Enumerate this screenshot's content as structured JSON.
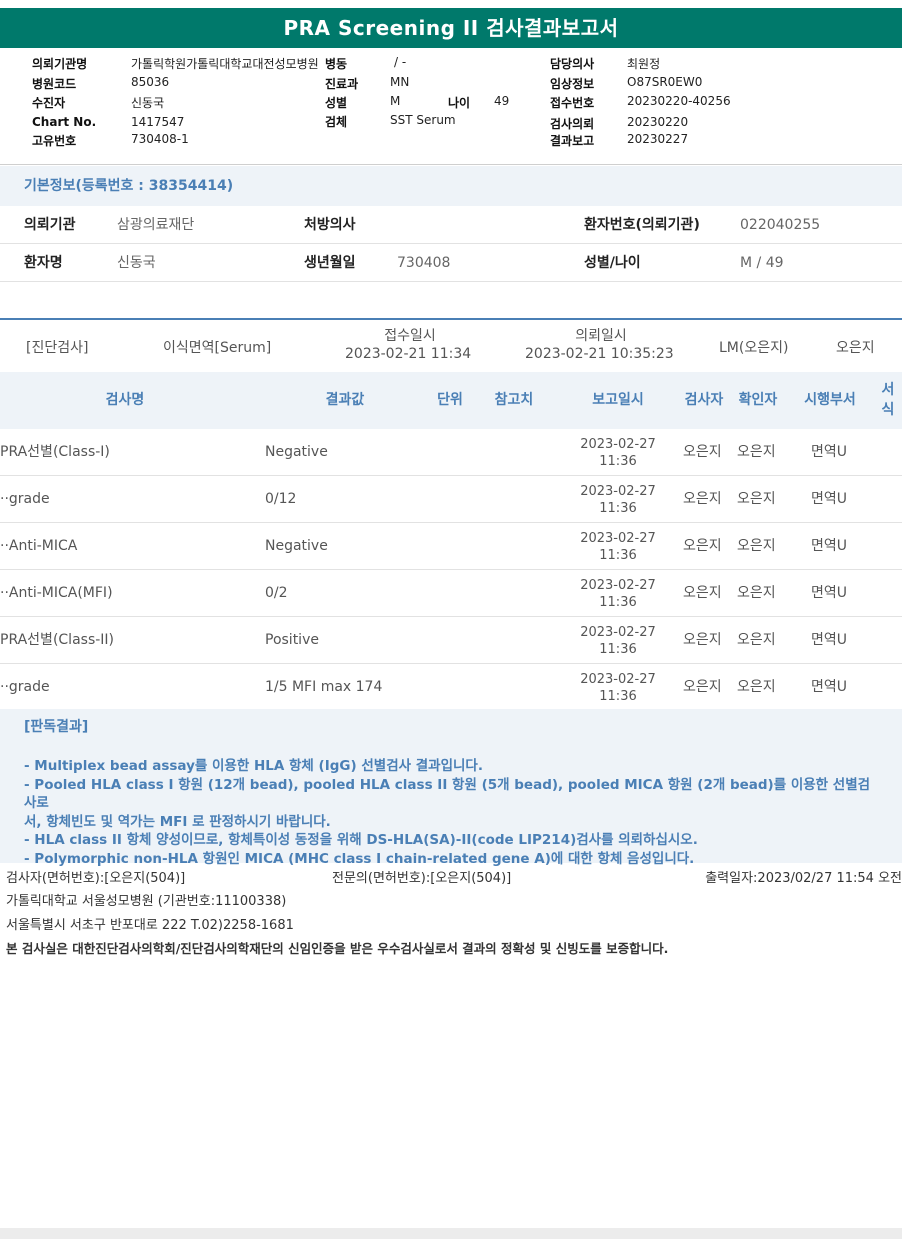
{
  "title": "PRA Screening II 검사결과보고서",
  "header": {
    "col1": [
      {
        "label": "의뢰기관명",
        "value": "가톨릭학원가톨릭대학교대전성모병원"
      },
      {
        "label": "병원코드",
        "value": "85036"
      },
      {
        "label": "수진자",
        "value": "신동국"
      },
      {
        "label": "Chart No.",
        "value": "1417547"
      },
      {
        "label": "고유번호",
        "value": "730408-1"
      }
    ],
    "col2": [
      {
        "label": "병동",
        "value": "/ -"
      },
      {
        "label": "진료과",
        "value": "MN"
      },
      {
        "label": "성별",
        "value": "M"
      },
      {
        "label": "검체",
        "value": "SST Serum"
      }
    ],
    "age": {
      "label": "나이",
      "value": "49"
    },
    "col3": [
      {
        "label": "담당의사",
        "value": "최원정"
      },
      {
        "label": "임상정보",
        "value": "O87SR0EW0"
      },
      {
        "label": "접수번호",
        "value": "20230220-40256"
      },
      {
        "label": "검사의뢰",
        "value": "20230220"
      },
      {
        "label": "결과보고",
        "value": "20230227"
      }
    ]
  },
  "basic_info": {
    "title": "기본정보(등록번호 : 38354414)",
    "row1": {
      "inst_label": "의뢰기관",
      "inst_value": "삼광의료재단",
      "doctor_label": "처방의사",
      "doctor_value": "",
      "patno_label": "환자번호(의뢰기관)",
      "patno_value": "022040255"
    },
    "row2": {
      "name_label": "환자명",
      "name_value": "신동국",
      "dob_label": "생년월일",
      "dob_value": "730408",
      "sexage_label": "성별/나이",
      "sexage_value": "M / 49"
    }
  },
  "diagnosis": {
    "category": "[진단검사]",
    "test": "이식면역[Serum]",
    "received_label": "접수일시",
    "received_value": "2023-02-21 11:34",
    "requested_label": "의뢰일시",
    "requested_value": "2023-02-21 10:35:23",
    "lm": "LM(오은지)",
    "person": "오은지"
  },
  "results_header": {
    "name": "검사명",
    "value": "결과값",
    "unit": "단위",
    "ref": "참고치",
    "report_dt": "보고일시",
    "tester": "검사자",
    "confirmer": "확인자",
    "dept": "시행부서",
    "sign1": "서",
    "sign2": "식"
  },
  "results": [
    {
      "name": "PRA선별(Class-I)",
      "value": "Negative",
      "date": "2023-02-27",
      "time": "11:36",
      "tester": "오은지",
      "confirmer": "오은지",
      "dept": "면역U"
    },
    {
      "name": "  ··grade",
      "value": "0/12",
      "date": "2023-02-27",
      "time": "11:36",
      "tester": "오은지",
      "confirmer": "오은지",
      "dept": "면역U"
    },
    {
      "name": "  ··Anti-MICA",
      "value": "Negative",
      "date": "2023-02-27",
      "time": "11:36",
      "tester": "오은지",
      "confirmer": "오은지",
      "dept": "면역U"
    },
    {
      "name": "  ··Anti-MICA(MFI)",
      "value": "0/2",
      "date": "2023-02-27",
      "time": "11:36",
      "tester": "오은지",
      "confirmer": "오은지",
      "dept": "면역U"
    },
    {
      "name": "PRA선별(Class-II)",
      "value": "Positive",
      "date": "2023-02-27",
      "time": "11:36",
      "tester": "오은지",
      "confirmer": "오은지",
      "dept": "면역U"
    },
    {
      "name": "  ··grade",
      "value": "1/5 MFI max 174",
      "date": "2023-02-27",
      "time": "11:36",
      "tester": "오은지",
      "confirmer": "오은지",
      "dept": "면역U"
    }
  ],
  "interpretation": {
    "title": "[판독결과]",
    "lines": [
      "- Multiplex bead assay를 이용한 HLA 항체 (IgG) 선별검사 결과입니다.",
      "- Pooled HLA class I 항원 (12개 bead), pooled HLA class II 항원 (5개 bead), pooled MICA 항원 (2개 bead)를 이용한 선별검사로",
      "서, 항체빈도 및 역가는 MFI 로 판정하시기 바랍니다.",
      "- HLA class II 항체 양성이므로, 항체특이성 동정을 위해 DS-HLA(SA)-II(code LIP214)검사를 의뢰하십시오.",
      "- Polymorphic non-HLA 항원인 MICA (MHC class I chain-related gene A)에 대한 항체 음성입니다."
    ]
  },
  "footer": {
    "tester": "검사자(면허번호):[오은지(504)]",
    "specialist": "전문의(면허번호):[오은지(504)]",
    "printed": "출력일자:2023/02/27 11:54 오전",
    "hospital": "가톨릭대학교 서울성모병원 (기관번호:11100338)",
    "address": "서울특별시 서초구 반포대로 222 T.02)2258-1681",
    "statement": "본 검사실은 대한진단검사의학회/진단검사의학재단의 신임인증을 받은 우수검사실로서 결과의 정확성 및 신빙도를 보증합니다."
  }
}
